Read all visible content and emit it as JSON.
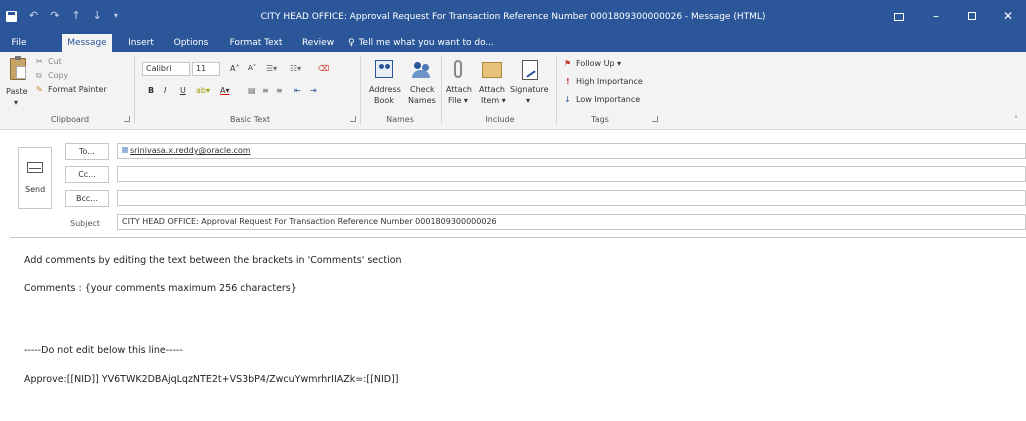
{
  "window": {
    "title": "CITY HEAD OFFICE: Approval Request For Transaction Reference Number 0001809300000026 - Message (HTML)",
    "qat_icons": [
      "save-icon",
      "undo-icon",
      "redo-icon",
      "up-arrow-icon",
      "down-arrow-icon",
      "customize-qat-icon"
    ],
    "controls": [
      "ribbon-display-options",
      "minimize",
      "restore",
      "close"
    ]
  },
  "tabs": [
    "File",
    "Message",
    "Insert",
    "Options",
    "Format Text",
    "Review"
  ],
  "tell_me": "Tell me what you want to do...",
  "ribbon": {
    "clipboard": {
      "paste": "Paste",
      "cut": "Cut",
      "copy": "Copy",
      "format_painter": "Format Painter",
      "label": "Clipboard"
    },
    "basic_text": {
      "font": "Calibri",
      "size": "11",
      "bold": "B",
      "italic": "I",
      "underline": "U",
      "label": "Basic Text"
    },
    "names": {
      "address_book": "Address\nBook",
      "address_book_l1": "Address",
      "address_book_l2": "Book",
      "check_names_l1": "Check",
      "check_names_l2": "Names",
      "label": "Names"
    },
    "include": {
      "attach_file_l1": "Attach",
      "attach_file_l2": "File",
      "attach_item_l1": "Attach",
      "attach_item_l2": "Item",
      "signature": "Signature",
      "label": "Include"
    },
    "tags": {
      "follow_up": "Follow Up",
      "high_importance": "High Importance",
      "low_importance": "Low Importance",
      "label": "Tags"
    }
  },
  "compose": {
    "send_label": "Send",
    "to_label": "To...",
    "cc_label": "Cc...",
    "bcc_label": "Bcc...",
    "subject_label": "Subject",
    "to_value": "srinivasa.x.reddy@oracle.com",
    "cc_value": "",
    "bcc_value": "",
    "subject_value": "CITY HEAD OFFICE: Approval Request For Transaction Reference Number 0001809300000026"
  },
  "body": {
    "line1": "Add comments by editing the text between the brackets in 'Comments' section",
    "line2": "Comments : {your comments maximum 256 characters}",
    "line3": "-----Do not edit below this line-----",
    "line4": "Approve:[[NID]] YV6TWK2DBAjqLqzNTE2t+VS3bP4/ZwcuYwmrhrIIAZk=:[[NID]]"
  },
  "colors": {
    "titlebar": "#2b579a",
    "ribbon": "#f3f3f3",
    "follow_up_flag": "#c0392b",
    "high_importance": "#c0392b",
    "low_importance": "#2b579a"
  }
}
